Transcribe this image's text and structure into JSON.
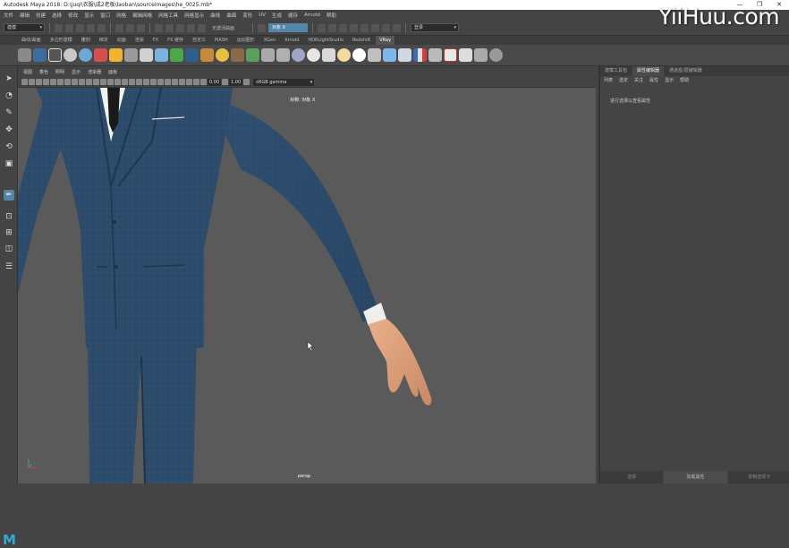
{
  "window": {
    "title": "Autodesk Maya 2018: D:\\juqi\\衣服\\成2老板\\laoban\\sourceimages\\he_0025.mb*",
    "controls": [
      "—",
      "❐",
      "✕"
    ]
  },
  "watermark": "YiiHuu.com",
  "menubar": [
    "文件",
    "编辑",
    "创建",
    "选择",
    "修改",
    "显示",
    "窗口",
    "网格",
    "编辑网格",
    "网格工具",
    "网格显示",
    "曲线",
    "曲面",
    "变形",
    "UV",
    "生成",
    "缓存",
    "Arnold",
    "帮助"
  ],
  "statusline": {
    "mode": "建模",
    "no_live_surface": "无激活曲面",
    "symmetry_field": "对象 X",
    "user": "登录"
  },
  "shelf_tabs": [
    "曲线/曲面",
    "多边形建模",
    "雕刻",
    "绑定",
    "动画",
    "渲染",
    "FX",
    "FX 缓存",
    "自定义",
    "MASH",
    "运动图形",
    "XGen",
    "Arnold",
    "HDRLightStudio",
    "Redshift",
    "VRay"
  ],
  "shelf_active": "VRay",
  "panel_menu": [
    "视图",
    "着色",
    "照明",
    "显示",
    "渲染器",
    "面板"
  ],
  "panel_toolbar": {
    "exposure": "0.00",
    "gamma": "1.00",
    "color_space": "sRGB gamma"
  },
  "viewport": {
    "symmetry_label": "对称: 对象 X",
    "camera": "persp"
  },
  "right_panel": {
    "tabs": [
      "建模工具包",
      "属性编辑器",
      "通道盒/层编辑器"
    ],
    "active_tab": "属性编辑器",
    "menu": [
      "列表",
      "选定",
      "关注",
      "属性",
      "显示",
      "帮助"
    ],
    "message": "进行选择以查看属性",
    "bottom_buttons": [
      "选择",
      "加载属性",
      "复制选项卡"
    ]
  },
  "colors": {
    "accent": "#5285a6",
    "ui_bg": "#444444",
    "viewport_bg": "#5a5a5a",
    "suit": "#2b4968",
    "skin": "#e0a67e"
  },
  "icons": [
    "select-arrow-icon",
    "lasso-icon",
    "paint-select-icon",
    "move-icon",
    "rotate-icon",
    "scale-icon",
    "sculpt-icon",
    "single-view-icon",
    "four-view-icon",
    "outliner-icon"
  ]
}
